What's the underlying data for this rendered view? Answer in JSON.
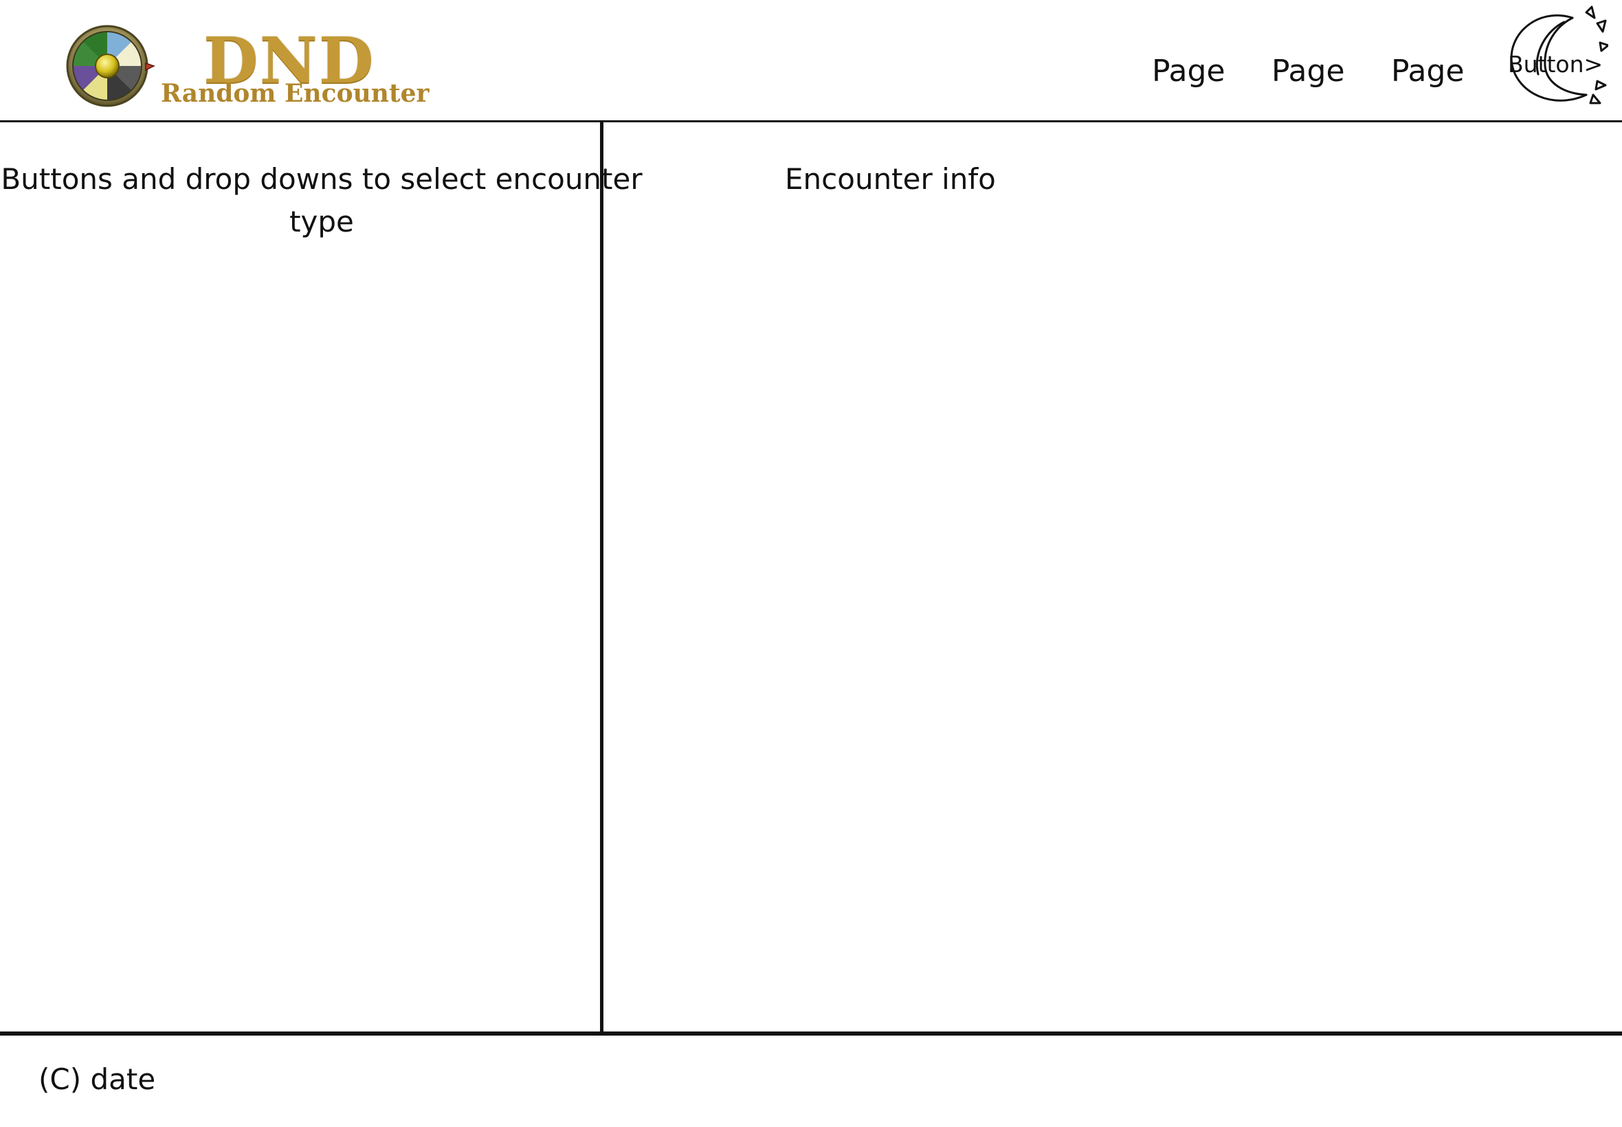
{
  "header": {
    "logo": {
      "title": "DND",
      "subtitle": "Random Encounter",
      "wheel_icon": "spinner-wheel-icon"
    },
    "nav": [
      {
        "label": "Page"
      },
      {
        "label": "Page"
      },
      {
        "label": "Page"
      }
    ],
    "button": {
      "label": "Button>",
      "icon": "sun-moon-icon"
    }
  },
  "sidebar": {
    "heading": "Buttons and drop downs to select encounter type"
  },
  "content": {
    "heading": "Encounter info"
  },
  "footer": {
    "text": "(C) date"
  },
  "colors": {
    "logo_gold": "#c39a37",
    "logo_subtitle_gold": "#b0862c",
    "line": "#111111",
    "background": "#ffffff"
  }
}
